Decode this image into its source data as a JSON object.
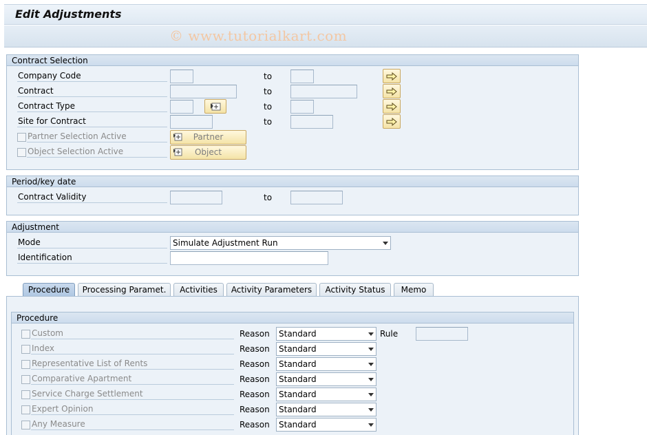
{
  "window": {
    "title": "Edit Adjustments"
  },
  "watermark": "© www.tutorialkart.com",
  "contract_selection": {
    "title": "Contract Selection",
    "rows": [
      {
        "label": "Company Code",
        "to": "to"
      },
      {
        "label": "Contract",
        "to": "to"
      },
      {
        "label": "Contract Type",
        "to": "to"
      },
      {
        "label": "Site for Contract",
        "to": "to"
      }
    ],
    "partner_label": "Partner Selection Active",
    "object_label": "Object Selection Active",
    "partner_button": "Partner",
    "object_button": "Object"
  },
  "period": {
    "title": "Period/key date",
    "label": "Contract Validity",
    "to": "to"
  },
  "adjustment": {
    "title": "Adjustment",
    "mode_label": "Mode",
    "mode_value": "Simulate Adjustment Run",
    "id_label": "Identification",
    "id_value": ""
  },
  "tabs": [
    "Procedure",
    "Processing Paramet.",
    "Activities",
    "Activity Parameters",
    "Activity Status",
    "Memo"
  ],
  "procedure": {
    "title": "Procedure",
    "reason_label": "Reason",
    "rule_label": "Rule",
    "rows": [
      {
        "label": "Custom",
        "reason": "Standard"
      },
      {
        "label": "Index",
        "reason": "Standard"
      },
      {
        "label": "Representative List of Rents",
        "reason": "Standard"
      },
      {
        "label": "Comparative Apartment",
        "reason": "Standard"
      },
      {
        "label": "Service Charge Settlement",
        "reason": "Standard"
      },
      {
        "label": "Expert Opinion",
        "reason": "Standard"
      },
      {
        "label": "Any Measure",
        "reason": "Standard"
      }
    ]
  },
  "colors": {
    "accent": "#aec7e2",
    "button": "#f4e3a7",
    "panel": "#ecf2f8"
  }
}
